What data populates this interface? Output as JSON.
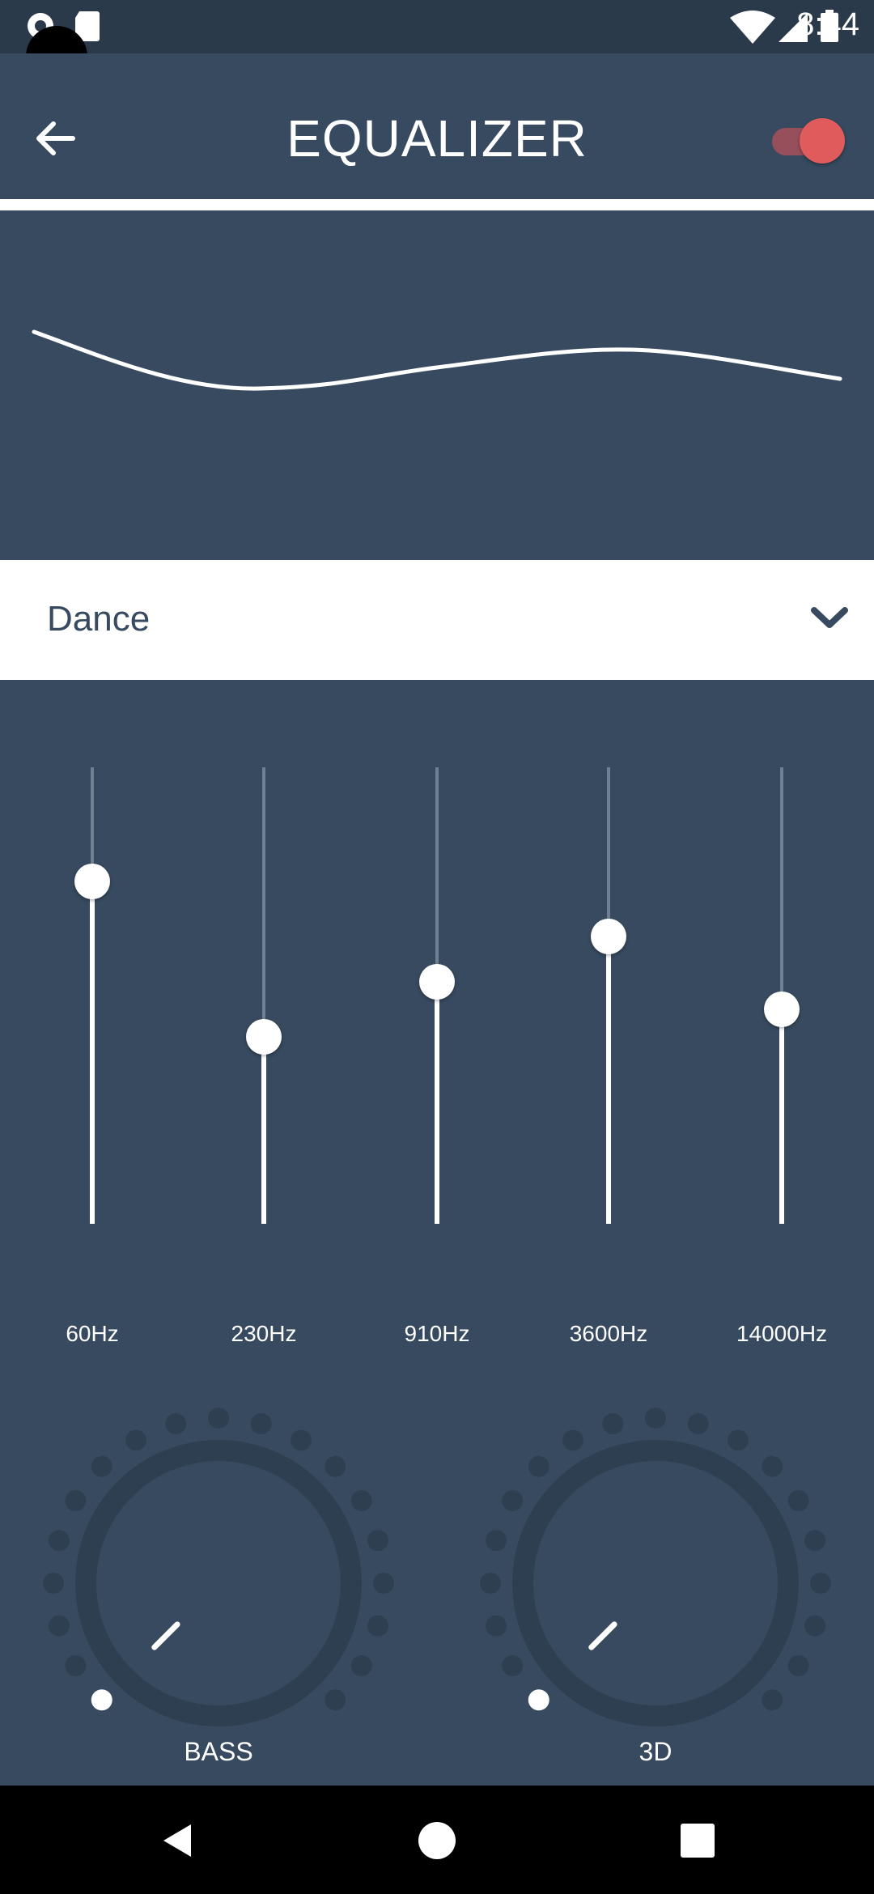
{
  "status_bar": {
    "time": "8:44",
    "icons_left": [
      "settings-gear-icon",
      "sd-card-icon"
    ],
    "icons_right": [
      "wifi-icon",
      "cell-signal-icon",
      "battery-icon"
    ]
  },
  "app_bar": {
    "title": "EQUALIZER",
    "back_icon": "arrow-left-icon",
    "toggle_on": true
  },
  "preset": {
    "selected": "Dance"
  },
  "bands": [
    {
      "label": "60Hz",
      "level": 0.75
    },
    {
      "label": "230Hz",
      "level": 0.41
    },
    {
      "label": "910Hz",
      "level": 0.53
    },
    {
      "label": "3600Hz",
      "level": 0.63
    },
    {
      "label": "14000Hz",
      "level": 0.47
    }
  ],
  "dials": [
    {
      "label": "BASS",
      "level": 0
    },
    {
      "label": "3D",
      "level": 0
    }
  ],
  "colors": {
    "background": "#374a5f",
    "accent": "#e05b5b",
    "status_bar": "#2b3a4b"
  },
  "nav_bar": {
    "buttons": [
      "back-triangle-icon",
      "home-circle-icon",
      "recents-square-icon"
    ]
  }
}
